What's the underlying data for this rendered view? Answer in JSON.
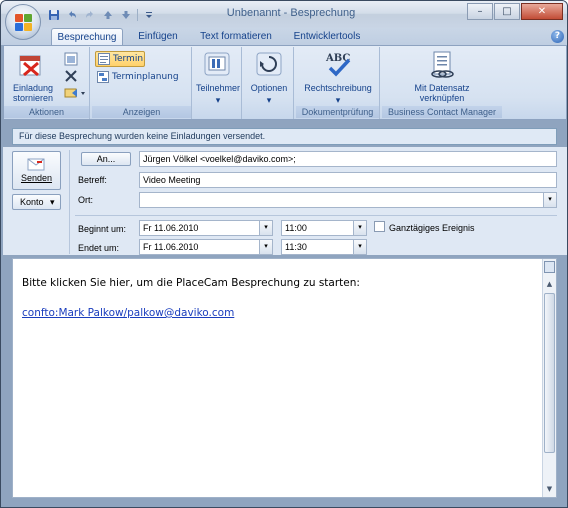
{
  "window": {
    "title": "Unbenannt - Besprechung",
    "minimize_glyph": "–",
    "maximize_glyph": "□",
    "close_glyph": "✕"
  },
  "quick_access": {
    "icons": [
      "save-icon",
      "undo-icon",
      "redo-icon",
      "up-arrow-icon",
      "down-arrow-icon",
      "customize-icon"
    ]
  },
  "tabs": [
    {
      "label": "Besprechung",
      "active": true
    },
    {
      "label": "Einfügen",
      "active": false
    },
    {
      "label": "Text formatieren",
      "active": false
    },
    {
      "label": "Entwicklertools",
      "active": false
    }
  ],
  "help_glyph": "?",
  "ribbon": {
    "aktionen": {
      "label": "Aktionen",
      "einladung_line1": "Einladung",
      "einladung_line2": "stornieren"
    },
    "anzeigen": {
      "label": "Anzeigen",
      "termin": "Termin",
      "terminplanung": "Terminplanung"
    },
    "teilnehmer": {
      "label": "Teilnehmer"
    },
    "optionen": {
      "label": "Optionen"
    },
    "dokumentpruefung": {
      "label": "Dokumentprüfung",
      "rechtschreibung": "Rechtschreibung",
      "abc_label": "ABC"
    },
    "bcm": {
      "label": "Business Contact Manager",
      "datensatz_line1": "Mit Datensatz",
      "datensatz_line2": "verknüpfen"
    },
    "dropdown_glyph": "▾"
  },
  "infobar": {
    "text": "Für diese Besprechung wurden keine Einladungen versendet."
  },
  "form": {
    "send_label": "Senden",
    "konto_label": "Konto",
    "konto_arrow": "▾",
    "an_button": "An...",
    "an_value": "Jürgen Völkel <voelkel@daviko.com>;",
    "betreff_label": "Betreff:",
    "betreff_value": "Video Meeting",
    "ort_label": "Ort:",
    "ort_value": "",
    "beginnt_label": "Beginnt um:",
    "beginnt_date": "Fr 11.06.2010",
    "beginnt_time": "11:00",
    "endet_label": "Endet um:",
    "endet_date": "Fr 11.06.2010",
    "endet_time": "11:30",
    "ganztaegig_label": "Ganztägiges Ereignis"
  },
  "body": {
    "text": "Bitte klicken Sie hier, um die PlaceCam Besprechung zu starten:",
    "link": "confto:Mark Palkow/palkow@daviko.com"
  },
  "colors": {
    "accent": "#15428b",
    "ribbon_bg": "#d6e2f1",
    "link": "#1a3dbd"
  }
}
